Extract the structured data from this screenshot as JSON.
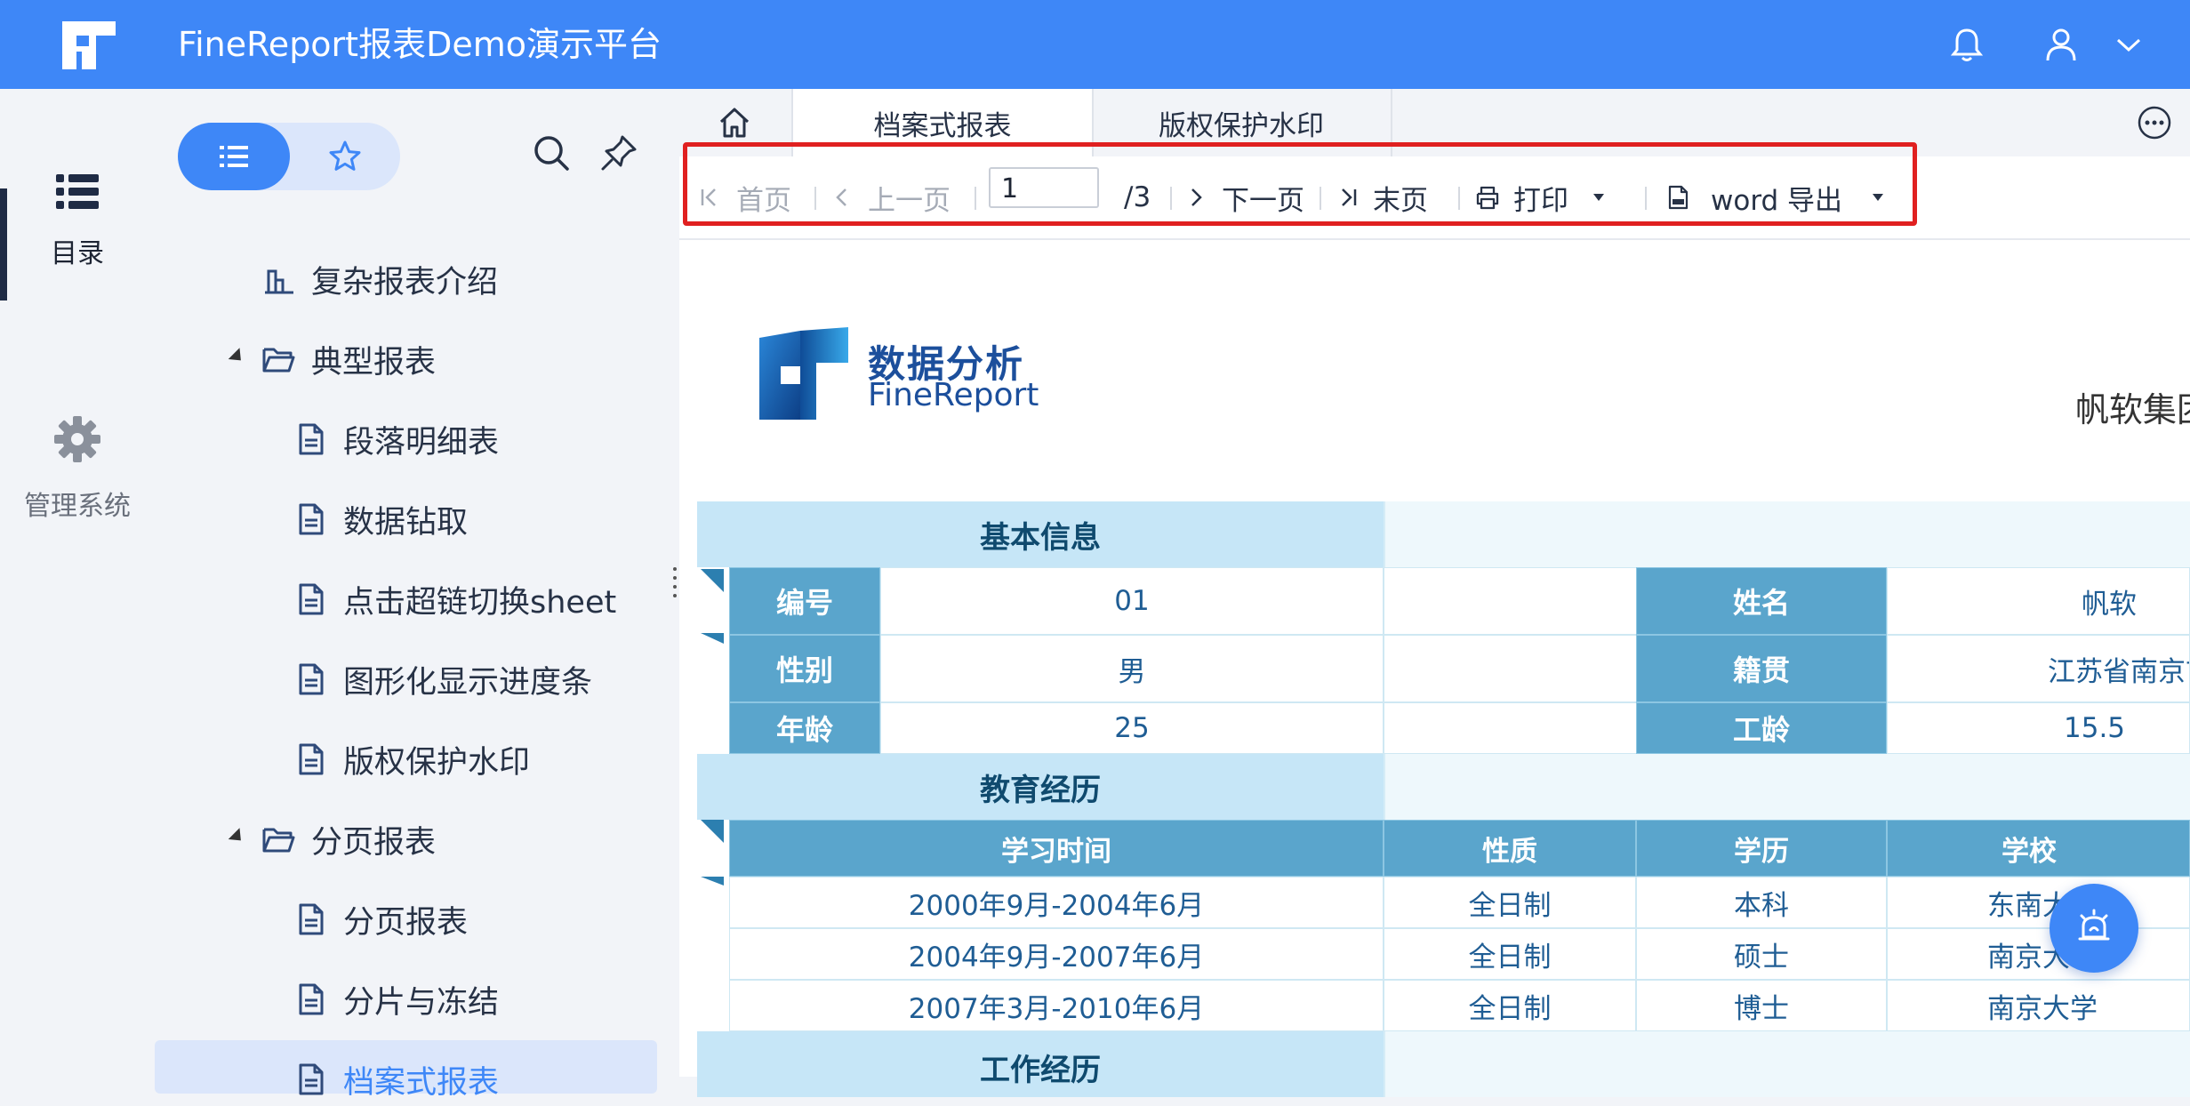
{
  "app": {
    "title": "FineReport报表Demo演示平台"
  },
  "rail": {
    "directory_label": "目录",
    "admin_label": "管理系统"
  },
  "tree": {
    "items": [
      {
        "label": "复杂报表介绍",
        "kind": "report-root"
      },
      {
        "label": "典型报表",
        "kind": "folder"
      },
      {
        "label": "段落明细表",
        "kind": "file"
      },
      {
        "label": "数据钻取",
        "kind": "file"
      },
      {
        "label": "点击超链切换sheet",
        "kind": "file"
      },
      {
        "label": "图形化显示进度条",
        "kind": "file"
      },
      {
        "label": "版权保护水印",
        "kind": "file"
      },
      {
        "label": "分页报表",
        "kind": "folder"
      },
      {
        "label": "分页报表",
        "kind": "file"
      },
      {
        "label": "分片与冻结",
        "kind": "file"
      },
      {
        "label": "档案式报表",
        "kind": "file",
        "selected": true
      }
    ]
  },
  "tabs": [
    {
      "label": "档案式报表",
      "active": true
    },
    {
      "label": "版权保护水印",
      "active": false
    }
  ],
  "toolbar": {
    "first": "首页",
    "prev": "上一页",
    "page_value": "1",
    "page_total": "/3",
    "next": "下一页",
    "last": "末页",
    "print": "打印",
    "export": "word 导出"
  },
  "report": {
    "logo_cn": "数据分析",
    "logo_en": "FineReport",
    "company": "帆软集团",
    "basic_title": "基本信息",
    "basic": {
      "id_label": "编号",
      "id_value": "01",
      "name_label": "姓名",
      "name_value": "帆软",
      "gender_label": "性别",
      "gender_value": "男",
      "origin_label": "籍贯",
      "origin_value": "江苏省南京市",
      "age_label": "年龄",
      "age_value": "25",
      "years_label": "工龄",
      "years_value": "15.5"
    },
    "edu_title": "教育经历",
    "edu_headers": [
      "学习时间",
      "性质",
      "学历",
      "学校"
    ],
    "edu_rows": [
      [
        "2000年9月-2004年6月",
        "全日制",
        "本科",
        "东南大学"
      ],
      [
        "2004年9月-2007年6月",
        "全日制",
        "硕士",
        "南京大学"
      ],
      [
        "2007年3月-2010年6月",
        "全日制",
        "博士",
        "南京大学"
      ]
    ],
    "work_title": "工作经历"
  },
  "colors": {
    "brand": "#3e87f7",
    "header_cell": "#5aa5cc",
    "section": "#c6e6f7",
    "highlight": "#e02020"
  }
}
